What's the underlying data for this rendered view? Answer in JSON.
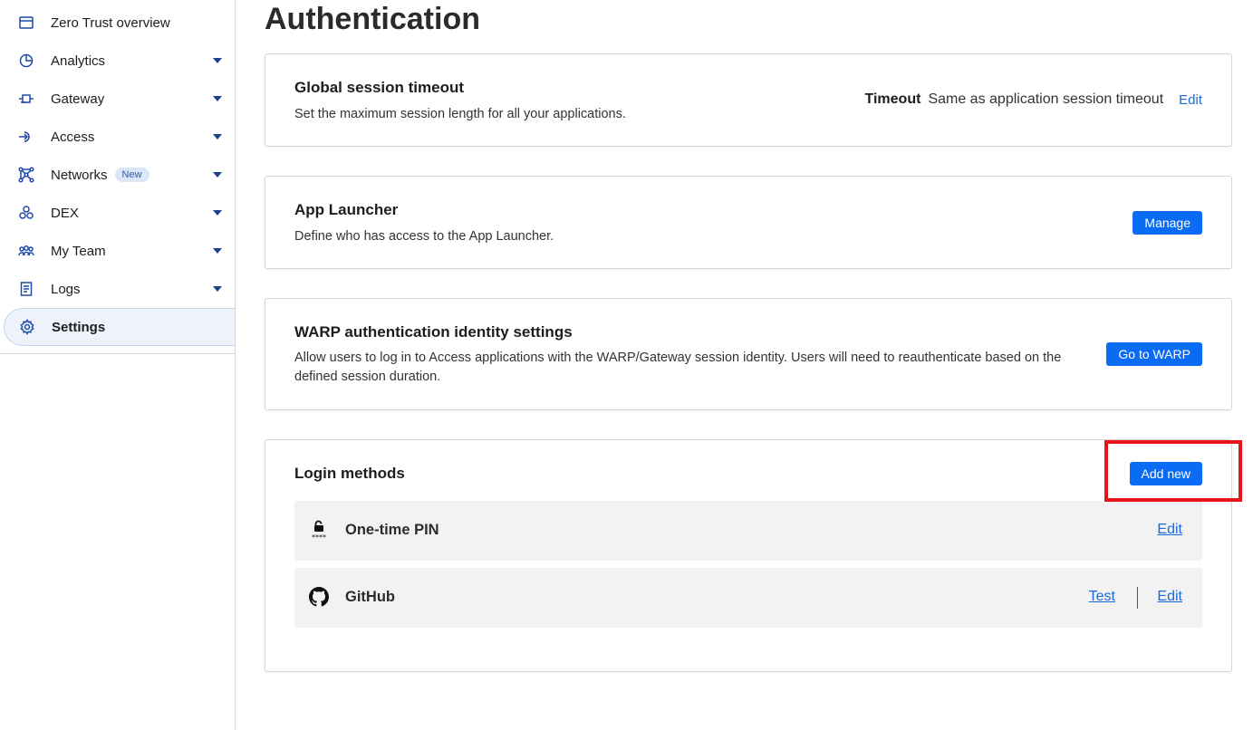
{
  "sidebar": {
    "items": [
      {
        "label": "Zero Trust overview",
        "icon": "browser-window-icon",
        "has_caret": false
      },
      {
        "label": "Analytics",
        "icon": "pie-chart-icon",
        "has_caret": true
      },
      {
        "label": "Gateway",
        "icon": "gateway-icon",
        "has_caret": true
      },
      {
        "label": "Access",
        "icon": "access-icon",
        "has_caret": true
      },
      {
        "label": "Networks",
        "icon": "network-icon",
        "has_caret": true,
        "badge": "New"
      },
      {
        "label": "DEX",
        "icon": "dex-icon",
        "has_caret": true
      },
      {
        "label": "My Team",
        "icon": "team-icon",
        "has_caret": true
      },
      {
        "label": "Logs",
        "icon": "logs-icon",
        "has_caret": true
      },
      {
        "label": "Settings",
        "icon": "gear-icon",
        "has_caret": false,
        "active": true
      }
    ]
  },
  "page": {
    "title": "Authentication"
  },
  "session_timeout": {
    "title": "Global session timeout",
    "description": "Set the maximum session length for all your applications.",
    "timeout_label": "Timeout",
    "timeout_value": "Same as application session timeout",
    "edit_label": "Edit"
  },
  "app_launcher": {
    "title": "App Launcher",
    "description": "Define who has access to the App Launcher.",
    "button_label": "Manage"
  },
  "warp_auth": {
    "title": "WARP authentication identity settings",
    "description": "Allow users to log in to Access applications with the WARP/Gateway session identity. Users will need to reauthenticate based on the defined session duration.",
    "button_label": "Go to WARP"
  },
  "login_methods": {
    "title": "Login methods",
    "add_label": "Add new",
    "methods": [
      {
        "name": "One-time PIN",
        "icon": "lock-pin-icon",
        "edit_label": "Edit"
      },
      {
        "name": "GitHub",
        "icon": "github-icon",
        "test_label": "Test",
        "edit_label": "Edit"
      }
    ]
  },
  "colors": {
    "accent": "#0a6cf5",
    "link": "#1a6ad8",
    "highlight": "#e8141c",
    "icon": "#1d4aa8"
  }
}
